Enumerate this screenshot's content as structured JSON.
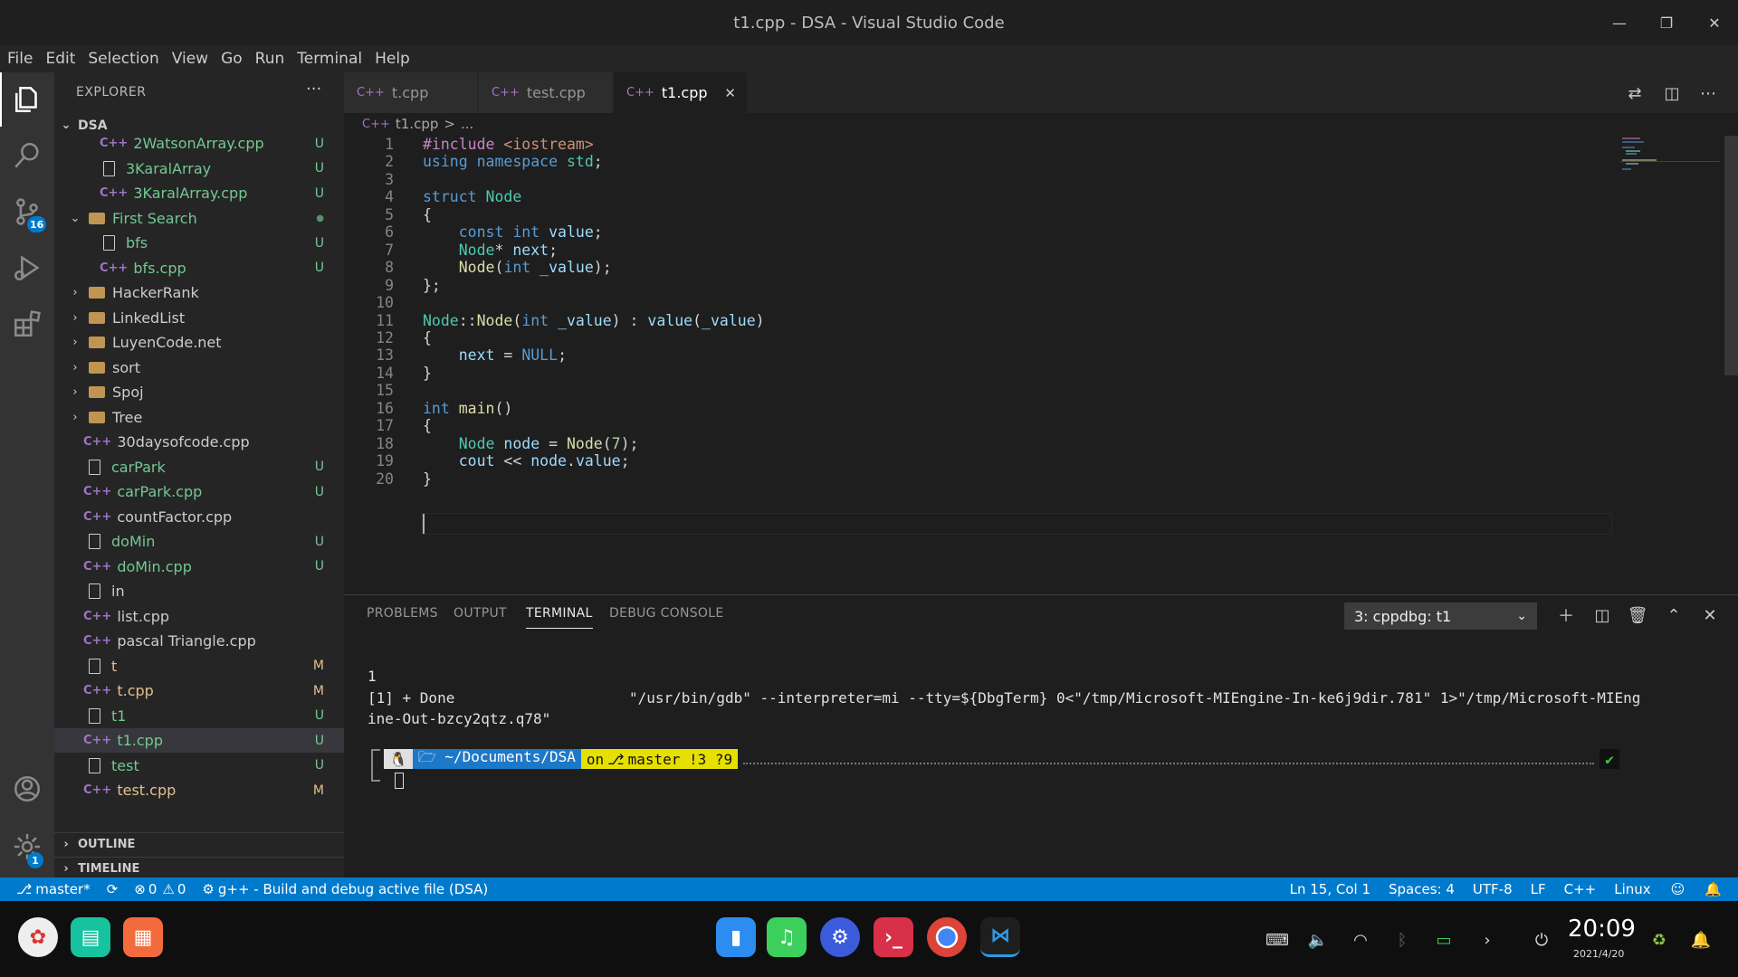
{
  "window": {
    "title": "t1.cpp - DSA - Visual Studio Code",
    "minimize": "—",
    "restore": "❐",
    "close": "✕"
  },
  "menu": [
    "File",
    "Edit",
    "Selection",
    "View",
    "Go",
    "Run",
    "Terminal",
    "Help"
  ],
  "activity": {
    "scm_badge": "16",
    "settings_badge": "1"
  },
  "sidebar": {
    "header": "EXPLORER",
    "more": "···",
    "root": "DSA",
    "items": [
      {
        "label": "2WatsonArray.cpp",
        "type": "cpp",
        "indent": 2,
        "status": "U"
      },
      {
        "label": "3KaralArray",
        "type": "file",
        "indent": 2,
        "status": "U"
      },
      {
        "label": "3KaralArray.cpp",
        "type": "cpp",
        "indent": 2,
        "status": "U"
      },
      {
        "label": "First Search",
        "type": "folder-open",
        "indent": 1,
        "status": "●"
      },
      {
        "label": "bfs",
        "type": "file",
        "indent": 2,
        "status": "U"
      },
      {
        "label": "bfs.cpp",
        "type": "cpp",
        "indent": 2,
        "status": "U"
      },
      {
        "label": "HackerRank",
        "type": "folder",
        "indent": 1,
        "status": ""
      },
      {
        "label": "LinkedList",
        "type": "folder",
        "indent": 1,
        "status": ""
      },
      {
        "label": "LuyenCode.net",
        "type": "folder",
        "indent": 1,
        "status": ""
      },
      {
        "label": "sort",
        "type": "folder",
        "indent": 1,
        "status": ""
      },
      {
        "label": "Spoj",
        "type": "folder",
        "indent": 1,
        "status": ""
      },
      {
        "label": "Tree",
        "type": "folder",
        "indent": 1,
        "status": ""
      },
      {
        "label": "30daysofcode.cpp",
        "type": "cpp",
        "indent": 1,
        "status": ""
      },
      {
        "label": "carPark",
        "type": "file",
        "indent": 1,
        "status": "U"
      },
      {
        "label": "carPark.cpp",
        "type": "cpp",
        "indent": 1,
        "status": "U"
      },
      {
        "label": "countFactor.cpp",
        "type": "cpp",
        "indent": 1,
        "status": ""
      },
      {
        "label": "doMin",
        "type": "file",
        "indent": 1,
        "status": "U"
      },
      {
        "label": "doMin.cpp",
        "type": "cpp",
        "indent": 1,
        "status": "U"
      },
      {
        "label": "in",
        "type": "file",
        "indent": 1,
        "status": ""
      },
      {
        "label": "list.cpp",
        "type": "cpp",
        "indent": 1,
        "status": ""
      },
      {
        "label": "pascal Triangle.cpp",
        "type": "cpp",
        "indent": 1,
        "status": ""
      },
      {
        "label": "t",
        "type": "file",
        "indent": 1,
        "status": "M"
      },
      {
        "label": "t.cpp",
        "type": "cpp",
        "indent": 1,
        "status": "M"
      },
      {
        "label": "t1",
        "type": "file",
        "indent": 1,
        "status": "U"
      },
      {
        "label": "t1.cpp",
        "type": "cpp",
        "indent": 1,
        "status": "U",
        "selected": true
      },
      {
        "label": "test",
        "type": "file",
        "indent": 1,
        "status": "U"
      },
      {
        "label": "test.cpp",
        "type": "cpp",
        "indent": 1,
        "status": "M"
      }
    ],
    "outline": "OUTLINE",
    "timeline": "TIMELINE"
  },
  "tabs": [
    {
      "label": "t.cpp",
      "active": false
    },
    {
      "label": "test.cpp",
      "active": false
    },
    {
      "label": "t1.cpp",
      "active": true
    }
  ],
  "tab_close": "✕",
  "breadcrumb": {
    "file": "t1.cpp",
    "sep": ">",
    "rest": "..."
  },
  "code": [
    [
      [
        "pp",
        "#include "
      ],
      [
        "st",
        "<iostream>"
      ]
    ],
    [
      [
        "kw",
        "using "
      ],
      [
        "kw",
        "namespace "
      ],
      [
        "ty",
        "std"
      ],
      [
        "tx",
        ";"
      ]
    ],
    [],
    [
      [
        "kw",
        "struct "
      ],
      [
        "ty",
        "Node"
      ]
    ],
    [
      [
        "tx",
        "{"
      ]
    ],
    [
      [
        "tx",
        "    "
      ],
      [
        "kw",
        "const "
      ],
      [
        "kw",
        "int "
      ],
      [
        "va",
        "value"
      ],
      [
        "tx",
        ";"
      ]
    ],
    [
      [
        "tx",
        "    "
      ],
      [
        "ty",
        "Node"
      ],
      [
        "tx",
        "* "
      ],
      [
        "va",
        "next"
      ],
      [
        "tx",
        ";"
      ]
    ],
    [
      [
        "tx",
        "    "
      ],
      [
        "fn",
        "Node"
      ],
      [
        "tx",
        "("
      ],
      [
        "kw",
        "int "
      ],
      [
        "va",
        "_value"
      ],
      [
        "tx",
        ");"
      ]
    ],
    [
      [
        "tx",
        "};"
      ]
    ],
    [],
    [
      [
        "ty",
        "Node"
      ],
      [
        "tx",
        "::"
      ],
      [
        "fn",
        "Node"
      ],
      [
        "tx",
        "("
      ],
      [
        "kw",
        "int "
      ],
      [
        "va",
        "_value"
      ],
      [
        "tx",
        ") : "
      ],
      [
        "va",
        "value"
      ],
      [
        "tx",
        "("
      ],
      [
        "va",
        "_value"
      ],
      [
        "tx",
        ")"
      ]
    ],
    [
      [
        "tx",
        "{"
      ]
    ],
    [
      [
        "tx",
        "    "
      ],
      [
        "va",
        "next"
      ],
      [
        "tx",
        " = "
      ],
      [
        "kw",
        "NULL"
      ],
      [
        "tx",
        ";"
      ]
    ],
    [
      [
        "tx",
        "}"
      ]
    ],
    [],
    [
      [
        "kw",
        "int "
      ],
      [
        "fn",
        "main"
      ],
      [
        "tx",
        "()"
      ]
    ],
    [
      [
        "tx",
        "{"
      ]
    ],
    [
      [
        "tx",
        "    "
      ],
      [
        "ty",
        "Node "
      ],
      [
        "va",
        "node"
      ],
      [
        "tx",
        " = "
      ],
      [
        "fn",
        "Node"
      ],
      [
        "tx",
        "("
      ],
      [
        "nu",
        "7"
      ],
      [
        "tx",
        ");"
      ]
    ],
    [
      [
        "tx",
        "    "
      ],
      [
        "va",
        "cout"
      ],
      [
        "tx",
        " << "
      ],
      [
        "va",
        "node"
      ],
      [
        "tx",
        "."
      ],
      [
        "va",
        "value"
      ],
      [
        "tx",
        ";"
      ]
    ],
    [
      [
        "tx",
        "}"
      ]
    ]
  ],
  "panel": {
    "tabs": [
      "PROBLEMS",
      "OUTPUT",
      "TERMINAL",
      "DEBUG CONSOLE"
    ],
    "active_tab": "TERMINAL",
    "terminal_select": "3: cppdbg: t1",
    "terminal_lines": [
      "1",
      "[1] + Done                    \"/usr/bin/gdb\" --interpreter=mi --tty=${DbgTerm} 0<\"/tmp/Microsoft-MIEngine-In-ke6j9dir.781\" 1>\"/tmp/Microsoft-MIEng",
      "ine-Out-bzcy2qtz.q78\""
    ],
    "prompt": {
      "os": "🐧",
      "path": "🗁 ~/Documents/DSA",
      "on": "on",
      "branch": "master !3 ?9",
      "ok": "✔"
    }
  },
  "statusbar": {
    "branch": "master*",
    "errors": "0",
    "warnings": "0",
    "task": "g++ - Build and debug active file (DSA)",
    "position": "Ln 15, Col 1",
    "spaces": "Spaces: 4",
    "encoding": "UTF-8",
    "eol": "LF",
    "language": "C++",
    "os": "Linux"
  },
  "taskbar": {
    "time": "20:09",
    "date": "2021/4/20"
  },
  "colors": {
    "accent": "#007acc",
    "untracked": "#73c991",
    "modified": "#e2c08d"
  }
}
